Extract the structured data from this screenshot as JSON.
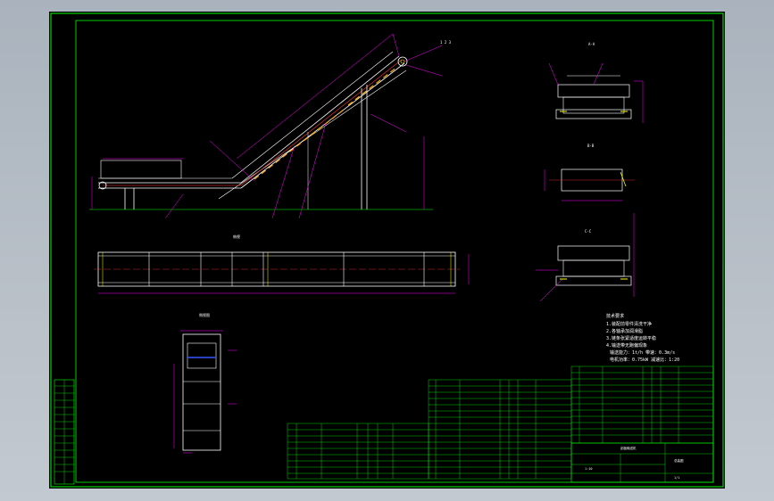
{
  "drawing": {
    "colors": {
      "viewport_bg": "#b4bcc6",
      "sheet_bg": "#000000",
      "border": "#00ff00",
      "dimension": "#ff00ff",
      "structure": "#ffffff",
      "center_line": "#ff3333",
      "hidden": "#ffff00",
      "chain": "#ffaa00",
      "blue_belt": "#3355ff"
    },
    "views": {
      "section_top": "A-A",
      "section_mid": "B-B",
      "section_right": "C-C",
      "plan_view": "俯视",
      "side_detail": "侧视图"
    },
    "notes": [
      "技术要求",
      "1.装配前零件清洗干净",
      "2.各轴承加润滑脂",
      "3.链条张紧适度运转平稳",
      "4.输送带无跑偏现象",
      "输送能力：1t/h  带速：0.3m/s",
      "电机功率：0.75kW  减速比：1:20"
    ],
    "title_block": {
      "name": "刮板输送机",
      "drawing_no": "总装图",
      "scale": "1:10",
      "sheet": "1/1"
    }
  }
}
